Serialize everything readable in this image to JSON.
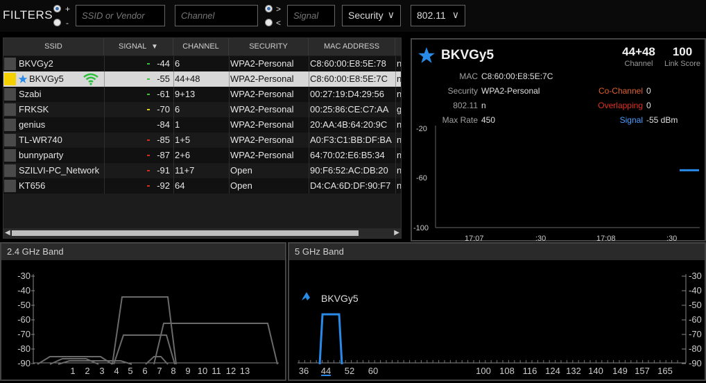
{
  "filters": {
    "label": "FILTERS",
    "radio1": {
      "plus": "+",
      "minus": "-"
    },
    "ssid_placeholder": "SSID or Vendor",
    "channel_placeholder": "Channel",
    "radio2": {
      "gt": ">",
      "lt": "<"
    },
    "signal_placeholder": "Signal",
    "security_label": "Security",
    "mode_label": "802.11",
    "chevron": "∨"
  },
  "table": {
    "columns": [
      "SSID",
      "SIGNAL",
      "CHANNEL",
      "SECURITY",
      "MAC ADDRESS"
    ],
    "sort_indicator": "▼",
    "rows": [
      {
        "ssid": "BKVGy2",
        "signal": "-44",
        "channel": "6",
        "security": "WPA2-Personal",
        "mac": "C8:60:00:E8:5E:78",
        "extra": "n",
        "sig_color": "#3ac03a"
      },
      {
        "ssid": "BKVGy5",
        "signal": "-55",
        "channel": "44+48",
        "security": "WPA2-Personal",
        "mac": "C8:60:00:E8:5E:7C",
        "extra": "n",
        "sig_color": "#3ac03a",
        "selected": true,
        "starred": true
      },
      {
        "ssid": "Szabi",
        "signal": "-61",
        "channel": "9+13",
        "security": "WPA2-Personal",
        "mac": "00:27:19:D4:29:56",
        "extra": "n",
        "sig_color": "#3ac03a"
      },
      {
        "ssid": "FRKSK",
        "signal": "-70",
        "channel": "6",
        "security": "WPA2-Personal",
        "mac": "00:25:86:CE:C7:AA",
        "extra": "g",
        "sig_color": "#e0d020"
      },
      {
        "ssid": "genius",
        "signal": "-84",
        "channel": "1",
        "security": "WPA2-Personal",
        "mac": "20:AA:4B:64:20:9C",
        "extra": "n",
        "sig_color": ""
      },
      {
        "ssid": "TL-WR740",
        "signal": "-85",
        "channel": "1+5",
        "security": "WPA2-Personal",
        "mac": "A0:F3:C1:BB:DF:BA",
        "extra": "n",
        "sig_color": "#d03020"
      },
      {
        "ssid": "bunnyparty",
        "signal": "-87",
        "channel": "2+6",
        "security": "WPA2-Personal",
        "mac": "64:70:02:E6:B5:34",
        "extra": "n",
        "sig_color": "#d03020"
      },
      {
        "ssid": "SZILVI-PC_Network",
        "signal": "-91",
        "channel": "11+7",
        "security": "Open",
        "mac": "90:F6:52:AC:DB:20",
        "extra": "n",
        "sig_color": "#d03020"
      },
      {
        "ssid": "KT656",
        "signal": "-92",
        "channel": "64",
        "security": "Open",
        "mac": "D4:CA:6D:DF:90:F7",
        "extra": "n",
        "sig_color": "#d03020"
      }
    ]
  },
  "detail": {
    "name": "BKVGy5",
    "channel_value": "44+48",
    "channel_label": "Channel",
    "link_score_value": "100",
    "link_score_label": "Link Score",
    "mac_label": "MAC",
    "mac_value": "C8:60:00:E8:5E:7C",
    "security_label": "Security",
    "security_value": "WPA2-Personal",
    "mode_label": "802.11",
    "mode_value": "n",
    "max_rate_label": "Max Rate",
    "max_rate_value": "450",
    "co_channel_label": "Co-Channel",
    "co_channel_value": "0",
    "overlapping_label": "Overlapping",
    "overlapping_value": "0",
    "signal_label": "Signal",
    "signal_value": "-55 dBm",
    "chart": {
      "y_ticks": [
        "-20",
        "-60",
        "-100"
      ],
      "x_ticks": [
        "17:07",
        ":30",
        "17:08",
        ":30"
      ],
      "signal_dbm": -55
    },
    "colors": {
      "co_channel": "#e06030",
      "overlapping": "#e03020",
      "signal": "#4aa0ff"
    }
  },
  "band24": {
    "title": "2.4 GHz Band",
    "y_ticks": [
      "-30",
      "-40",
      "-50",
      "-60",
      "-70",
      "-80",
      "-90"
    ],
    "x_ticks": [
      "1",
      "2",
      "3",
      "4",
      "5",
      "6",
      "7",
      "8",
      "9",
      "10",
      "11",
      "12",
      "13"
    ]
  },
  "band5": {
    "title": "5 GHz Band",
    "y_ticks": [
      "-30",
      "-40",
      "-50",
      "-60",
      "-70",
      "-80",
      "-90"
    ],
    "x_ticks": [
      "36",
      "44",
      "52",
      "60",
      "100",
      "108",
      "116",
      "124",
      "132",
      "140",
      "149",
      "157",
      "165"
    ],
    "highlight_label": "BKVGy5",
    "highlight_tick": "44"
  }
}
